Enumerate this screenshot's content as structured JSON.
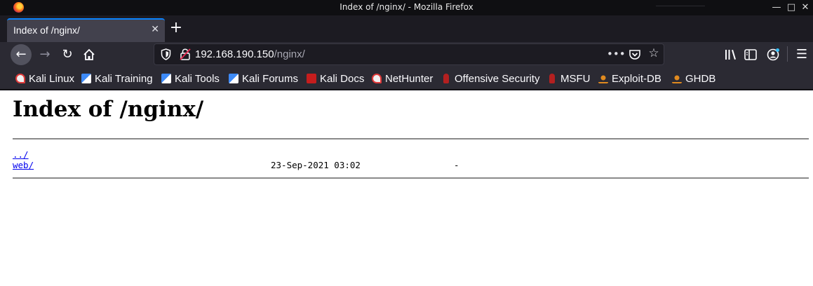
{
  "window": {
    "title": "Index of /nginx/ - Mozilla Firefox"
  },
  "tab": {
    "title": "Index of /nginx/"
  },
  "urlbar": {
    "host": "192.168.190.150",
    "path": "/nginx/"
  },
  "bookmarks": [
    {
      "label": "Kali Linux",
      "icon": "kali-icon"
    },
    {
      "label": "Kali Training",
      "icon": "kali-training-icon"
    },
    {
      "label": "Kali Tools",
      "icon": "kali-tools-icon"
    },
    {
      "label": "Kali Forums",
      "icon": "kali-forums-icon"
    },
    {
      "label": "Kali Docs",
      "icon": "kali-docs-icon"
    },
    {
      "label": "NetHunter",
      "icon": "nethunter-icon"
    },
    {
      "label": "Offensive Security",
      "icon": "offsec-icon"
    },
    {
      "label": "MSFU",
      "icon": "msfu-icon"
    },
    {
      "label": "Exploit-DB",
      "icon": "exploit-db-icon"
    },
    {
      "label": "GHDB",
      "icon": "ghdb-icon"
    }
  ],
  "page": {
    "heading": "Index of /nginx/",
    "entries": [
      {
        "name": "../",
        "date": "",
        "size": ""
      },
      {
        "name": "web/",
        "date": "23-Sep-2021 03:02",
        "size": "-"
      }
    ]
  },
  "colors": {
    "accent": "#0a84ff",
    "link": "#0000ee",
    "toolbar": "#2b2a33"
  }
}
